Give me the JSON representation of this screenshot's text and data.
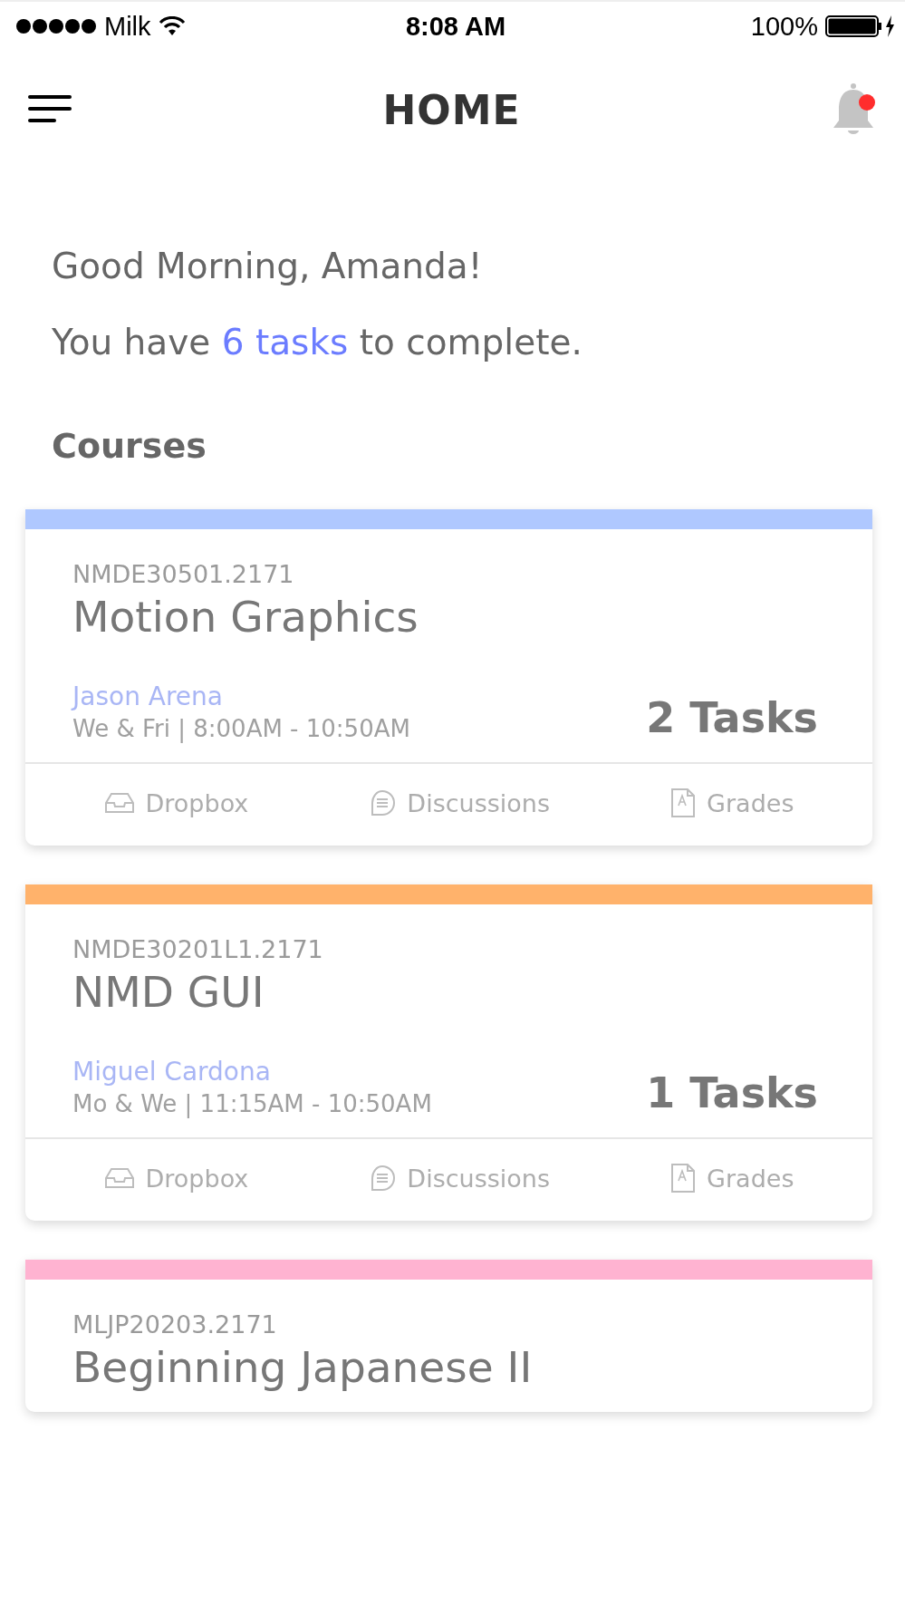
{
  "status_bar": {
    "carrier": "Milk",
    "time": "8:08 AM",
    "battery": "100%"
  },
  "header": {
    "title": "HOME",
    "notification_unread": true
  },
  "greeting": {
    "line_1": "Good Morning, Amanda!",
    "line_2_before": "You have ",
    "tasks_link": "6 tasks",
    "line_2_after": " to complete."
  },
  "courses": {
    "heading": "Courses",
    "items": [
      {
        "code": "NMDE30501.2171",
        "title": "Motion Graphics",
        "instructor": "Jason Arena",
        "schedule": "We & Fri | 8:00AM - 10:50AM",
        "tasks": "2 Tasks",
        "color": "#afc8ff",
        "actions": [
          {
            "kind": "dropbox",
            "label": "Dropbox"
          },
          {
            "kind": "discussions",
            "label": "Discussions"
          },
          {
            "kind": "grades",
            "label": "Grades"
          }
        ]
      },
      {
        "code": "NMDE30201L1.2171",
        "title": "NMD GUI",
        "instructor": "Miguel Cardona",
        "schedule": "Mo & We | 11:15AM - 10:50AM",
        "tasks": "1 Tasks",
        "color": "#ffb26b",
        "actions": [
          {
            "kind": "dropbox",
            "label": "Dropbox"
          },
          {
            "kind": "discussions",
            "label": "Discussions"
          },
          {
            "kind": "grades",
            "label": "Grades"
          }
        ]
      },
      {
        "code": "MLJP20203.2171",
        "title": "Beginning Japanese II",
        "color": "#ffb3d1"
      }
    ]
  }
}
